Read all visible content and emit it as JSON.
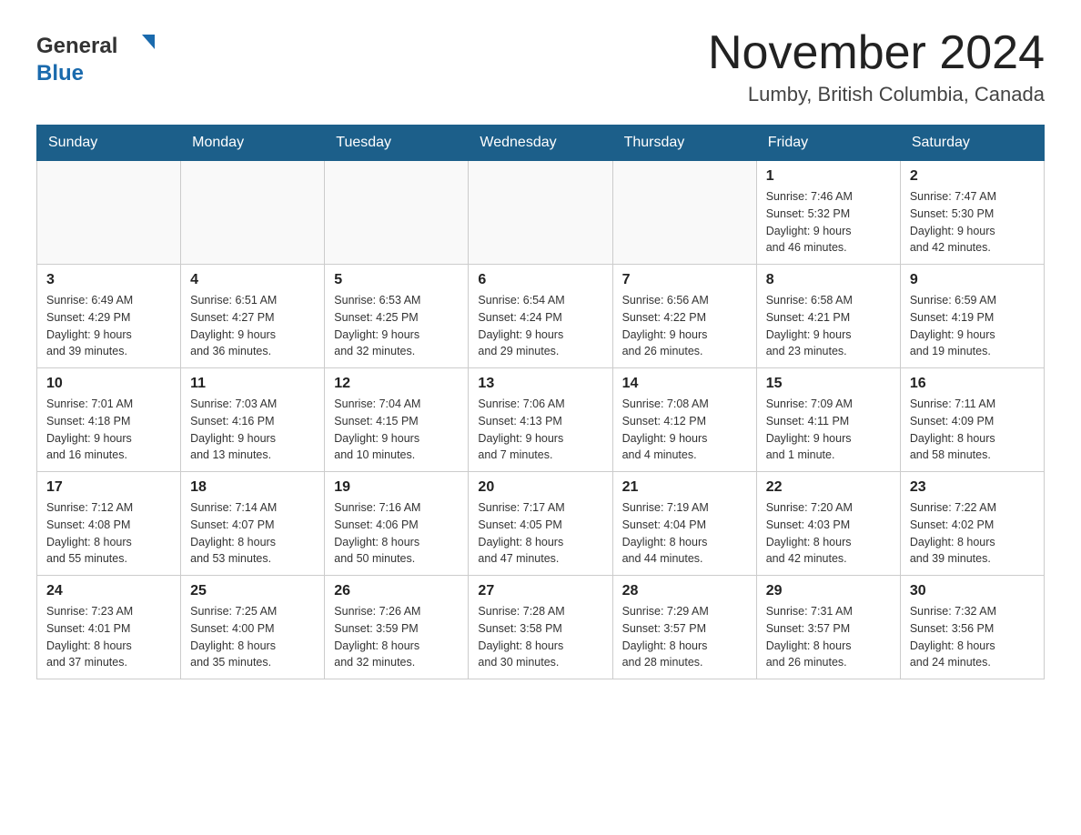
{
  "logo": {
    "general": "General",
    "blue": "Blue"
  },
  "title": "November 2024",
  "subtitle": "Lumby, British Columbia, Canada",
  "weekdays": [
    "Sunday",
    "Monday",
    "Tuesday",
    "Wednesday",
    "Thursday",
    "Friday",
    "Saturday"
  ],
  "weeks": [
    [
      {
        "day": "",
        "info": ""
      },
      {
        "day": "",
        "info": ""
      },
      {
        "day": "",
        "info": ""
      },
      {
        "day": "",
        "info": ""
      },
      {
        "day": "",
        "info": ""
      },
      {
        "day": "1",
        "info": "Sunrise: 7:46 AM\nSunset: 5:32 PM\nDaylight: 9 hours\nand 46 minutes."
      },
      {
        "day": "2",
        "info": "Sunrise: 7:47 AM\nSunset: 5:30 PM\nDaylight: 9 hours\nand 42 minutes."
      }
    ],
    [
      {
        "day": "3",
        "info": "Sunrise: 6:49 AM\nSunset: 4:29 PM\nDaylight: 9 hours\nand 39 minutes."
      },
      {
        "day": "4",
        "info": "Sunrise: 6:51 AM\nSunset: 4:27 PM\nDaylight: 9 hours\nand 36 minutes."
      },
      {
        "day": "5",
        "info": "Sunrise: 6:53 AM\nSunset: 4:25 PM\nDaylight: 9 hours\nand 32 minutes."
      },
      {
        "day": "6",
        "info": "Sunrise: 6:54 AM\nSunset: 4:24 PM\nDaylight: 9 hours\nand 29 minutes."
      },
      {
        "day": "7",
        "info": "Sunrise: 6:56 AM\nSunset: 4:22 PM\nDaylight: 9 hours\nand 26 minutes."
      },
      {
        "day": "8",
        "info": "Sunrise: 6:58 AM\nSunset: 4:21 PM\nDaylight: 9 hours\nand 23 minutes."
      },
      {
        "day": "9",
        "info": "Sunrise: 6:59 AM\nSunset: 4:19 PM\nDaylight: 9 hours\nand 19 minutes."
      }
    ],
    [
      {
        "day": "10",
        "info": "Sunrise: 7:01 AM\nSunset: 4:18 PM\nDaylight: 9 hours\nand 16 minutes."
      },
      {
        "day": "11",
        "info": "Sunrise: 7:03 AM\nSunset: 4:16 PM\nDaylight: 9 hours\nand 13 minutes."
      },
      {
        "day": "12",
        "info": "Sunrise: 7:04 AM\nSunset: 4:15 PM\nDaylight: 9 hours\nand 10 minutes."
      },
      {
        "day": "13",
        "info": "Sunrise: 7:06 AM\nSunset: 4:13 PM\nDaylight: 9 hours\nand 7 minutes."
      },
      {
        "day": "14",
        "info": "Sunrise: 7:08 AM\nSunset: 4:12 PM\nDaylight: 9 hours\nand 4 minutes."
      },
      {
        "day": "15",
        "info": "Sunrise: 7:09 AM\nSunset: 4:11 PM\nDaylight: 9 hours\nand 1 minute."
      },
      {
        "day": "16",
        "info": "Sunrise: 7:11 AM\nSunset: 4:09 PM\nDaylight: 8 hours\nand 58 minutes."
      }
    ],
    [
      {
        "day": "17",
        "info": "Sunrise: 7:12 AM\nSunset: 4:08 PM\nDaylight: 8 hours\nand 55 minutes."
      },
      {
        "day": "18",
        "info": "Sunrise: 7:14 AM\nSunset: 4:07 PM\nDaylight: 8 hours\nand 53 minutes."
      },
      {
        "day": "19",
        "info": "Sunrise: 7:16 AM\nSunset: 4:06 PM\nDaylight: 8 hours\nand 50 minutes."
      },
      {
        "day": "20",
        "info": "Sunrise: 7:17 AM\nSunset: 4:05 PM\nDaylight: 8 hours\nand 47 minutes."
      },
      {
        "day": "21",
        "info": "Sunrise: 7:19 AM\nSunset: 4:04 PM\nDaylight: 8 hours\nand 44 minutes."
      },
      {
        "day": "22",
        "info": "Sunrise: 7:20 AM\nSunset: 4:03 PM\nDaylight: 8 hours\nand 42 minutes."
      },
      {
        "day": "23",
        "info": "Sunrise: 7:22 AM\nSunset: 4:02 PM\nDaylight: 8 hours\nand 39 minutes."
      }
    ],
    [
      {
        "day": "24",
        "info": "Sunrise: 7:23 AM\nSunset: 4:01 PM\nDaylight: 8 hours\nand 37 minutes."
      },
      {
        "day": "25",
        "info": "Sunrise: 7:25 AM\nSunset: 4:00 PM\nDaylight: 8 hours\nand 35 minutes."
      },
      {
        "day": "26",
        "info": "Sunrise: 7:26 AM\nSunset: 3:59 PM\nDaylight: 8 hours\nand 32 minutes."
      },
      {
        "day": "27",
        "info": "Sunrise: 7:28 AM\nSunset: 3:58 PM\nDaylight: 8 hours\nand 30 minutes."
      },
      {
        "day": "28",
        "info": "Sunrise: 7:29 AM\nSunset: 3:57 PM\nDaylight: 8 hours\nand 28 minutes."
      },
      {
        "day": "29",
        "info": "Sunrise: 7:31 AM\nSunset: 3:57 PM\nDaylight: 8 hours\nand 26 minutes."
      },
      {
        "day": "30",
        "info": "Sunrise: 7:32 AM\nSunset: 3:56 PM\nDaylight: 8 hours\nand 24 minutes."
      }
    ]
  ]
}
